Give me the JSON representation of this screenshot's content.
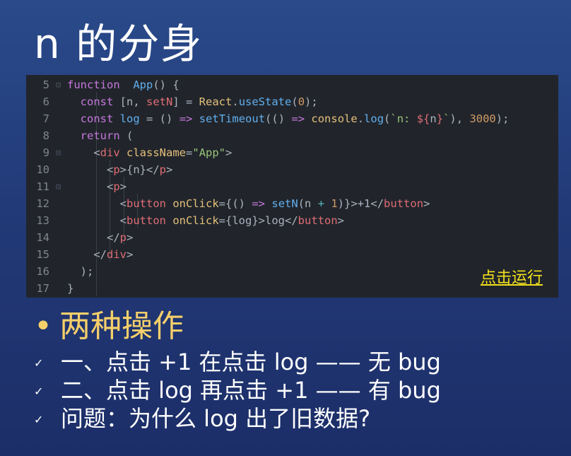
{
  "title": "n 的分身",
  "code": {
    "lines": [
      {
        "n": "5",
        "fold": true,
        "tokens": [
          [
            "k",
            "function"
          ],
          [
            "",
            "  "
          ],
          [
            "f",
            "App"
          ],
          [
            "",
            "() {"
          ]
        ]
      },
      {
        "n": "6",
        "fold": false,
        "tokens": [
          [
            "",
            "  "
          ],
          [
            "k",
            "const"
          ],
          [
            "",
            " [n, "
          ],
          [
            "r",
            "setN"
          ],
          [
            "",
            "] = "
          ],
          [
            "y",
            "React"
          ],
          [
            "",
            "."
          ],
          [
            "f",
            "useState"
          ],
          [
            "",
            "("
          ],
          [
            "n",
            "0"
          ],
          [
            "",
            ");"
          ]
        ]
      },
      {
        "n": "7",
        "fold": false,
        "tokens": [
          [
            "",
            "  "
          ],
          [
            "k",
            "const"
          ],
          [
            "",
            " "
          ],
          [
            "f",
            "log"
          ],
          [
            "",
            " = () "
          ],
          [
            "k",
            "=>"
          ],
          [
            "",
            " "
          ],
          [
            "f",
            "setTimeout"
          ],
          [
            "",
            "(() "
          ],
          [
            "k",
            "=>"
          ],
          [
            "",
            " "
          ],
          [
            "y",
            "console"
          ],
          [
            "",
            "."
          ],
          [
            "f",
            "log"
          ],
          [
            "",
            "("
          ],
          [
            "s",
            "`n: "
          ],
          [
            "r",
            "${"
          ],
          [
            "",
            "n"
          ],
          [
            "r",
            "}"
          ],
          [
            "s",
            "`"
          ],
          [
            "",
            ")"
          ],
          [
            "",
            ", "
          ],
          [
            "n",
            "3000"
          ],
          [
            "",
            ");"
          ]
        ]
      },
      {
        "n": "8",
        "fold": false,
        "tokens": [
          [
            "",
            "  "
          ],
          [
            "k",
            "return"
          ],
          [
            "",
            " ("
          ]
        ]
      },
      {
        "n": "9",
        "fold": true,
        "tokens": [
          [
            "",
            "    <"
          ],
          [
            "r",
            "div"
          ],
          [
            "",
            " "
          ],
          [
            "y",
            "className"
          ],
          [
            "",
            "="
          ],
          [
            "s",
            "\"App\""
          ],
          [
            "",
            ">"
          ]
        ]
      },
      {
        "n": "10",
        "fold": false,
        "tokens": [
          [
            "",
            "      <"
          ],
          [
            "r",
            "p"
          ],
          [
            "",
            ">{n}</"
          ],
          [
            "r",
            "p"
          ],
          [
            "",
            ">"
          ]
        ]
      },
      {
        "n": "11",
        "fold": true,
        "tokens": [
          [
            "",
            "      <"
          ],
          [
            "r",
            "p"
          ],
          [
            "",
            ">"
          ]
        ]
      },
      {
        "n": "12",
        "fold": false,
        "tokens": [
          [
            "",
            "        <"
          ],
          [
            "r",
            "button"
          ],
          [
            "",
            " "
          ],
          [
            "y",
            "onClick"
          ],
          [
            "",
            "={() "
          ],
          [
            "k",
            "=>"
          ],
          [
            "",
            " "
          ],
          [
            "f",
            "setN"
          ],
          [
            "",
            "(n "
          ],
          [
            "c",
            "+"
          ],
          [
            "",
            " "
          ],
          [
            "n",
            "1"
          ],
          [
            "",
            ")}>+1</"
          ],
          [
            "r",
            "button"
          ],
          [
            "",
            ">"
          ]
        ]
      },
      {
        "n": "13",
        "fold": false,
        "tokens": [
          [
            "",
            "        <"
          ],
          [
            "r",
            "button"
          ],
          [
            "",
            " "
          ],
          [
            "y",
            "onClick"
          ],
          [
            "",
            "={log}>log</"
          ],
          [
            "r",
            "button"
          ],
          [
            "",
            ">"
          ]
        ]
      },
      {
        "n": "14",
        "fold": false,
        "tokens": [
          [
            "",
            "      </"
          ],
          [
            "r",
            "p"
          ],
          [
            "",
            ">"
          ]
        ]
      },
      {
        "n": "15",
        "fold": false,
        "tokens": [
          [
            "",
            "    </"
          ],
          [
            "r",
            "div"
          ],
          [
            "",
            ">"
          ]
        ]
      },
      {
        "n": "16",
        "fold": false,
        "tokens": [
          [
            "",
            "  );"
          ]
        ]
      },
      {
        "n": "17",
        "fold": false,
        "tokens": [
          [
            "",
            "}"
          ]
        ]
      }
    ],
    "run_link": "点击运行"
  },
  "bullets": {
    "main": "两种操作",
    "items": [
      "一、点击 +1 在点击 log —— 无 bug",
      "二、点击 log 再点击 +1 —— 有 bug",
      "问题：为什么 log 出了旧数据?"
    ],
    "check_icon": "✓",
    "dot_icon": "•"
  }
}
